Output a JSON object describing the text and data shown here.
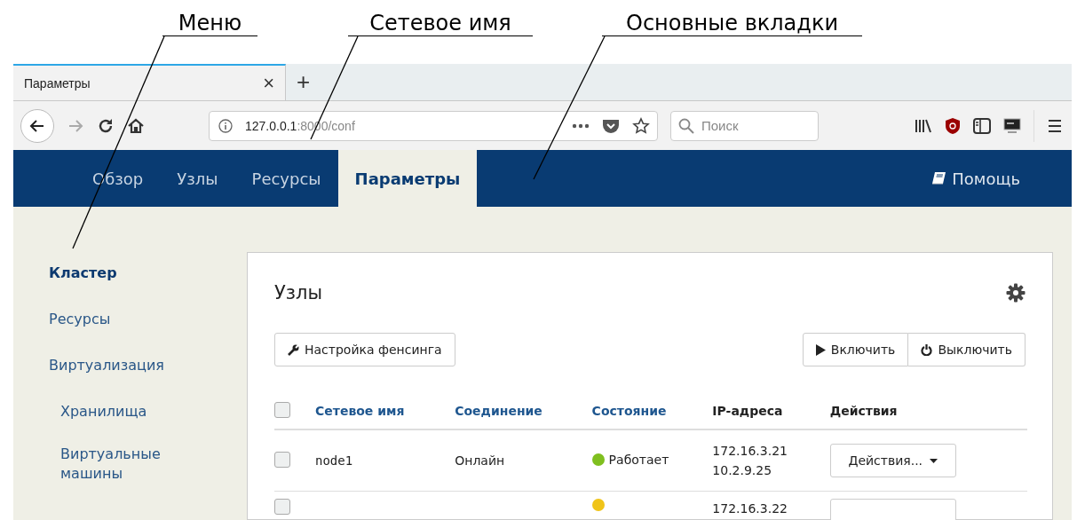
{
  "annotations": [
    {
      "label": "Меню"
    },
    {
      "label": "Сетевое имя"
    },
    {
      "label": "Основные вкладки"
    }
  ],
  "browser": {
    "tab": {
      "title": "Параметры",
      "close": "×"
    },
    "new_tab": "+",
    "url": {
      "host": "127.0.0.1",
      "rest": ":8000/conf"
    },
    "search": {
      "placeholder": "Поиск"
    }
  },
  "nav": {
    "tabs": [
      {
        "label": "Обзор",
        "selected": false
      },
      {
        "label": "Узлы",
        "selected": false
      },
      {
        "label": "Ресурсы",
        "selected": false
      },
      {
        "label": "Параметры",
        "selected": true
      }
    ],
    "help": "Помощь"
  },
  "sidebar": {
    "items": [
      {
        "label": "Кластер",
        "selected": true
      },
      {
        "label": "Ресурсы",
        "selected": false
      },
      {
        "label": "Виртуализация",
        "selected": false,
        "children": [
          {
            "label": "Хранилища",
            "selected": false
          },
          {
            "label": "Виртуальные машины",
            "selected": false
          }
        ]
      }
    ]
  },
  "panel": {
    "title": "Узлы",
    "fencing_button": "Настройка фенсинга",
    "start_button": "Включить",
    "stop_button": "Выключить",
    "header_checkbox": {
      "checked": false
    },
    "columns": [
      {
        "label": "Сетевое имя",
        "sortable": true
      },
      {
        "label": "Соединение",
        "sortable": true
      },
      {
        "label": "Состояние",
        "sortable": true
      },
      {
        "label": "IP-адреса",
        "sortable": false
      },
      {
        "label": "Действия",
        "sortable": false
      }
    ],
    "rows": [
      {
        "checked": false,
        "hostname": "node1",
        "connection": "Онлайн",
        "status": "Работает",
        "color": "#7fbf1f",
        "ips": [
          "172.16.3.21",
          "10.2.9.25"
        ],
        "action": "Действия..."
      },
      {
        "checked": false,
        "color": "#f0c419",
        "ips": [
          "172.16.3.22"
        ]
      }
    ]
  }
}
